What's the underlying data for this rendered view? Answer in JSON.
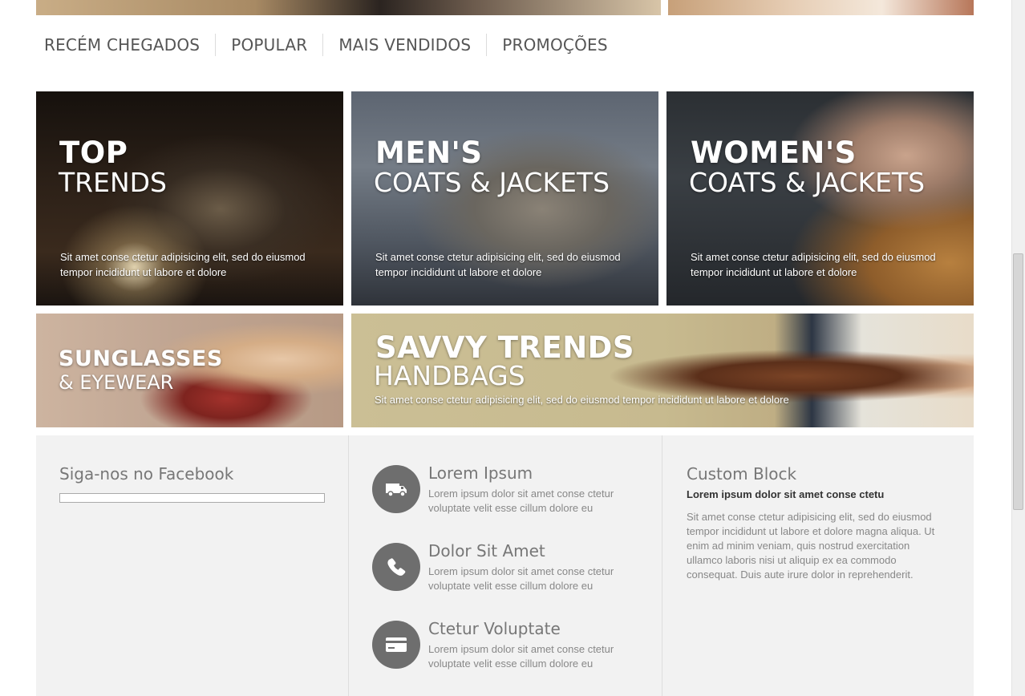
{
  "tabs": [
    "RECÉM CHEGADOS",
    "POPULAR",
    "MAIS VENDIDOS",
    "PROMOÇÕES"
  ],
  "banners": {
    "top_trends": {
      "title1": "TOP",
      "title2": "TRENDS",
      "desc_line1": "Sit amet conse ctetur adipisicing elit, sed do eiusmod",
      "desc_line2": "tempor incididunt ut labore et dolore"
    },
    "mens": {
      "title1": "MEN'S",
      "title2": "COATS & JACKETS",
      "desc_line1": "Sit amet conse ctetur adipisicing elit, sed do eiusmod",
      "desc_line2": "tempor incididunt ut labore et dolore"
    },
    "womens": {
      "title1": "WOMEN'S",
      "title2": "COATS & JACKETS",
      "desc_line1": "Sit amet conse ctetur adipisicing elit, sed do eiusmod",
      "desc_line2": "tempor incididunt ut labore et dolore"
    },
    "sunglasses": {
      "title1": "SUNGLASSES",
      "title2": "& EYEWEAR"
    },
    "savvy": {
      "title1": "SAVVY TRENDS",
      "title2": "HANDBAGS",
      "desc": "Sit amet conse ctetur adipisicing elit, sed do eiusmod tempor incididunt ut labore et dolore"
    }
  },
  "facebook": {
    "title": "Siga-nos no Facebook"
  },
  "features": [
    {
      "icon": "truck-icon",
      "title": "Lorem Ipsum",
      "text": "Lorem ipsum dolor sit amet conse ctetur voluptate velit esse cillum dolore eu"
    },
    {
      "icon": "phone-icon",
      "title": "Dolor Sit Amet",
      "text": "Lorem ipsum dolor sit amet conse ctetur voluptate velit esse cillum dolore eu"
    },
    {
      "icon": "credit-card-icon",
      "title": "Ctetur Voluptate",
      "text": "Lorem ipsum dolor sit amet conse ctetur voluptate velit esse cillum dolore eu"
    }
  ],
  "custom_block": {
    "title": "Custom Block",
    "subtitle": "Lorem ipsum dolor sit amet conse ctetu",
    "text": "Sit amet conse ctetur adipisicing elit, sed do eiusmod tempor incididunt ut labore et dolore magna aliqua. Ut enim ad minim veniam, quis nostrud exercitation ullamco laboris nisi ut aliquip ex ea commodo consequat. Duis aute irure dolor in reprehenderit."
  },
  "colors": {
    "tab_text": "#555555",
    "bottom_bg": "#f2f2f2",
    "icon_circle": "#6e6e6e",
    "heading_gray": "#777777",
    "body_gray": "#888888"
  }
}
